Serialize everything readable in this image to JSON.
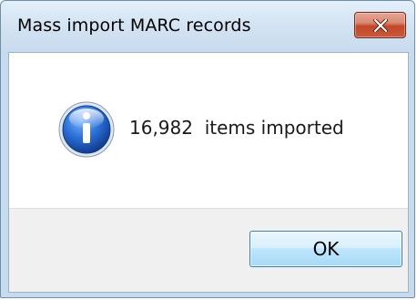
{
  "dialog": {
    "title": "Mass import MARC records",
    "message_count": "16,982",
    "message_text": "items imported",
    "ok_label": "OK"
  },
  "icons": {
    "close": "close-icon",
    "info": "info-icon"
  },
  "colors": {
    "close_button": "#c2472a",
    "info_icon_blue": "#1f5fbf",
    "ok_button_border": "#3c7fb1"
  }
}
